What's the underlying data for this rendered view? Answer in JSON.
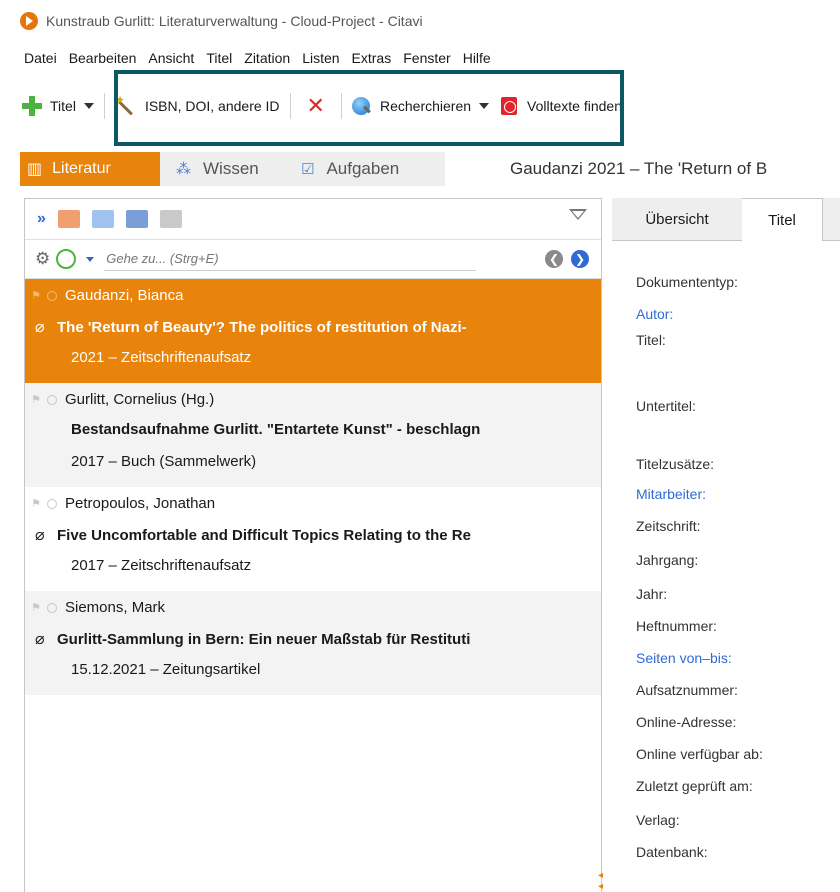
{
  "window": {
    "title": "Kunstraub Gurlitt: Literaturverwaltung - Cloud-Project - Citavi"
  },
  "menu": [
    "Datei",
    "Bearbeiten",
    "Ansicht",
    "Titel",
    "Zitation",
    "Listen",
    "Extras",
    "Fenster",
    "Hilfe"
  ],
  "toolbar": {
    "titel_label": "Titel",
    "isbn_label": "ISBN, DOI, andere ID",
    "recherchieren_label": "Recherchieren",
    "volltexte_label": "Volltexte finden"
  },
  "main_tabs": {
    "literatur": "Literatur",
    "wissen": "Wissen",
    "aufgaben": "Aufgaben"
  },
  "current_title": "Gaudanzi 2021 – The 'Return of B",
  "search": {
    "placeholder": "Gehe zu... (Strg+E)"
  },
  "references": [
    {
      "author": "Gaudanzi, Bianca",
      "title": "The 'Return of Beauty'? The politics of restitution of Nazi-",
      "meta": "2021 – Zeitschriftenaufsatz",
      "attachment": true
    },
    {
      "author": "Gurlitt, Cornelius (Hg.)",
      "title": "Bestandsaufnahme Gurlitt. \"Entartete Kunst\" - beschlagn",
      "meta": "2017 – Buch (Sammelwerk)",
      "attachment": false
    },
    {
      "author": "Petropoulos, Jonathan",
      "title": "Five Uncomfortable and Difficult Topics Relating to the Re",
      "meta": "2017 – Zeitschriftenaufsatz",
      "attachment": true
    },
    {
      "author": "Siemons, Mark",
      "title": "Gurlitt-Sammlung in Bern: Ein neuer Maßstab für Restituti",
      "meta": "15.12.2021 – Zeitungsartikel",
      "attachment": true
    }
  ],
  "detail_tabs": {
    "uebersicht": "Übersicht",
    "titel": "Titel"
  },
  "fields": {
    "dokumententyp": "Dokumententyp:",
    "autor": "Autor:",
    "titel": "Titel:",
    "untertitel": "Untertitel:",
    "titelzusaetze": "Titelzusätze:",
    "mitarbeiter": "Mitarbeiter:",
    "zeitschrift": "Zeitschrift:",
    "jahrgang": "Jahrgang:",
    "jahr": "Jahr:",
    "heftnummer": "Heftnummer:",
    "seiten": "Seiten von–bis:",
    "aufsatznummer": "Aufsatznummer:",
    "online_adresse": "Online-Adresse:",
    "online_verfuegbar": "Online verfügbar ab:",
    "zuletzt_geprueft": "Zuletzt geprüft am:",
    "verlag": "Verlag:",
    "datenbank": "Datenbank:"
  },
  "colors": {
    "accent": "#e8840c",
    "highlight_box": "#0d5963",
    "link": "#2f6bd4"
  }
}
